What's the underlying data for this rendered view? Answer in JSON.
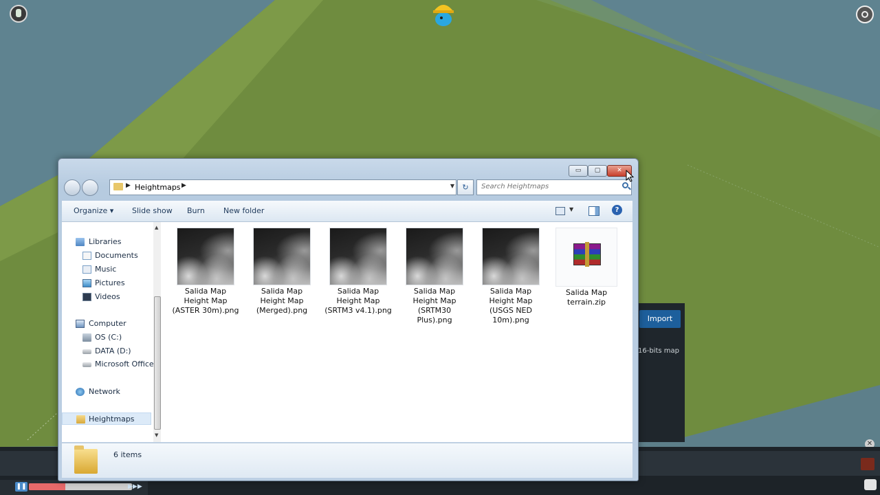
{
  "game": {
    "import_label": "Import",
    "bits_label": "16-bits map",
    "panel_close_glyph": "✕",
    "pause_glyph": "❚❚",
    "speed_glyph": "▶▶▶",
    "speed_fill_fraction": 0.35
  },
  "window": {
    "minimize_glyph": "▭",
    "maximize_glyph": "▢",
    "close_glyph": "✕"
  },
  "address": {
    "crumb": "Heightmaps",
    "arrow": "▶",
    "dropdown_glyph": "▼",
    "refresh_glyph": "↻"
  },
  "search": {
    "placeholder": "Search Heightmaps"
  },
  "toolbar": {
    "organize": "Organize ▾",
    "slideshow": "Slide show",
    "burn": "Burn",
    "new_folder": "New folder",
    "views_dropdown_glyph": "▼",
    "help_glyph": "?"
  },
  "nav": {
    "scroll_up": "▲",
    "scroll_down": "▼",
    "libraries": "Libraries",
    "documents": "Documents",
    "music": "Music",
    "pictures": "Pictures",
    "videos": "Videos",
    "computer": "Computer",
    "os_c": "OS (C:)",
    "data_d": "DATA (D:)",
    "microsoft_office": "Microsoft Office",
    "network": "Network",
    "heightmaps": "Heightmaps"
  },
  "files": [
    {
      "name": "Salida Map Height Map (ASTER 30m).png",
      "icon": "heightmap-thumbnail"
    },
    {
      "name": "Salida Map Height Map (Merged).png",
      "icon": "heightmap-thumbnail"
    },
    {
      "name": "Salida Map Height Map (SRTM3 v4.1).png",
      "icon": "heightmap-thumbnail"
    },
    {
      "name": "Salida Map Height Map (SRTM30 Plus).png",
      "icon": "heightmap-thumbnail"
    },
    {
      "name": "Salida Map Height Map (USGS NED 10m).png",
      "icon": "heightmap-thumbnail"
    },
    {
      "name": "Salida Map terrain.zip",
      "icon": "winrar-archive-icon"
    }
  ],
  "details": {
    "count": "6 items"
  }
}
